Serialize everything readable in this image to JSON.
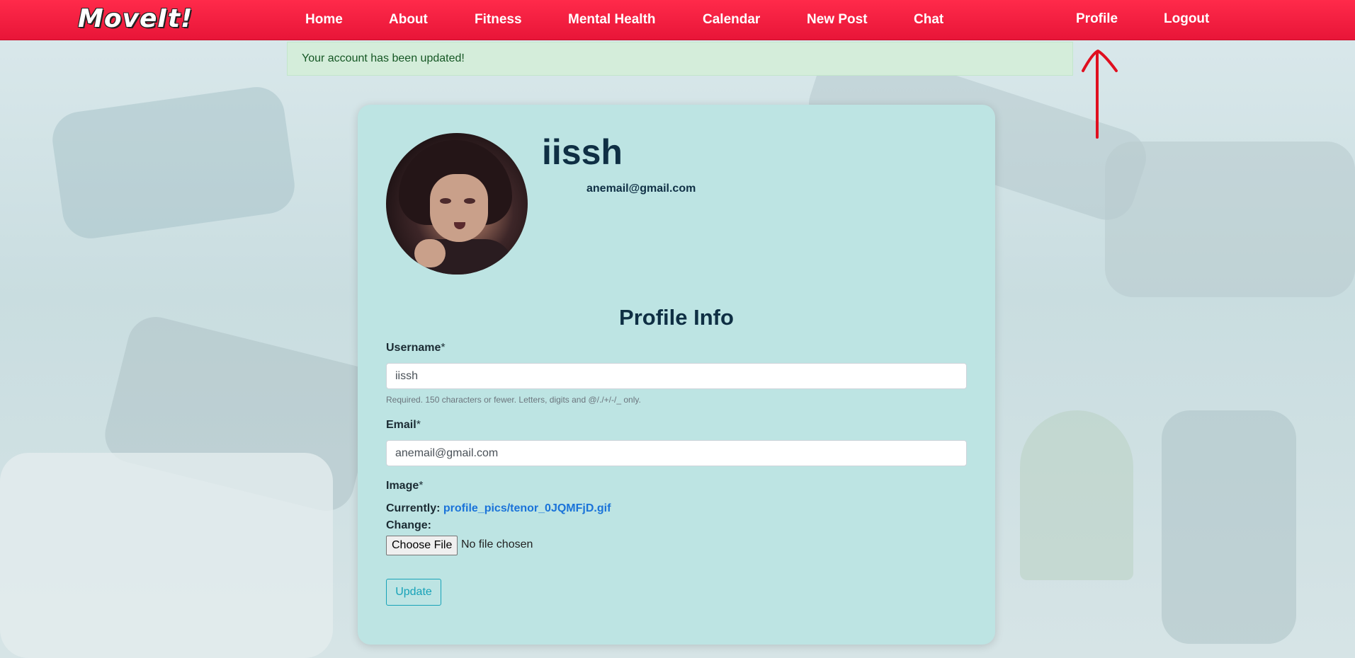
{
  "navbar": {
    "logo": "MoveIt!",
    "links": [
      "Home",
      "About",
      "Fitness",
      "Mental Health",
      "Calendar",
      "New Post",
      "Chat"
    ],
    "profile": "Profile",
    "logout": "Logout"
  },
  "flash": {
    "message": "Your account has been updated!"
  },
  "profile": {
    "username": "iissh",
    "email": "anemail@gmail.com"
  },
  "form": {
    "title": "Profile Info",
    "username_label": "Username",
    "username_value": "iissh",
    "username_help": "Required. 150 characters or fewer. Letters, digits and @/./+/-/_ only.",
    "email_label": "Email",
    "email_value": "anemail@gmail.com",
    "required_mark": "*",
    "image_label": "Image",
    "currently_label": "Currently:",
    "current_file": "profile_pics/tenor_0JQMFjD.gif",
    "change_label": "Change:",
    "choose_file": "Choose File",
    "no_file": "No file chosen",
    "update_button": "Update"
  },
  "colors": {
    "navbar": "#ff2a4a",
    "card": "#bde4e3",
    "flash_bg": "#d4edda",
    "link": "#1a73d9",
    "update_button": "#17a2b8",
    "annotation": "#e00f1f"
  },
  "icons": [
    "up-arrow-annotation-icon"
  ]
}
